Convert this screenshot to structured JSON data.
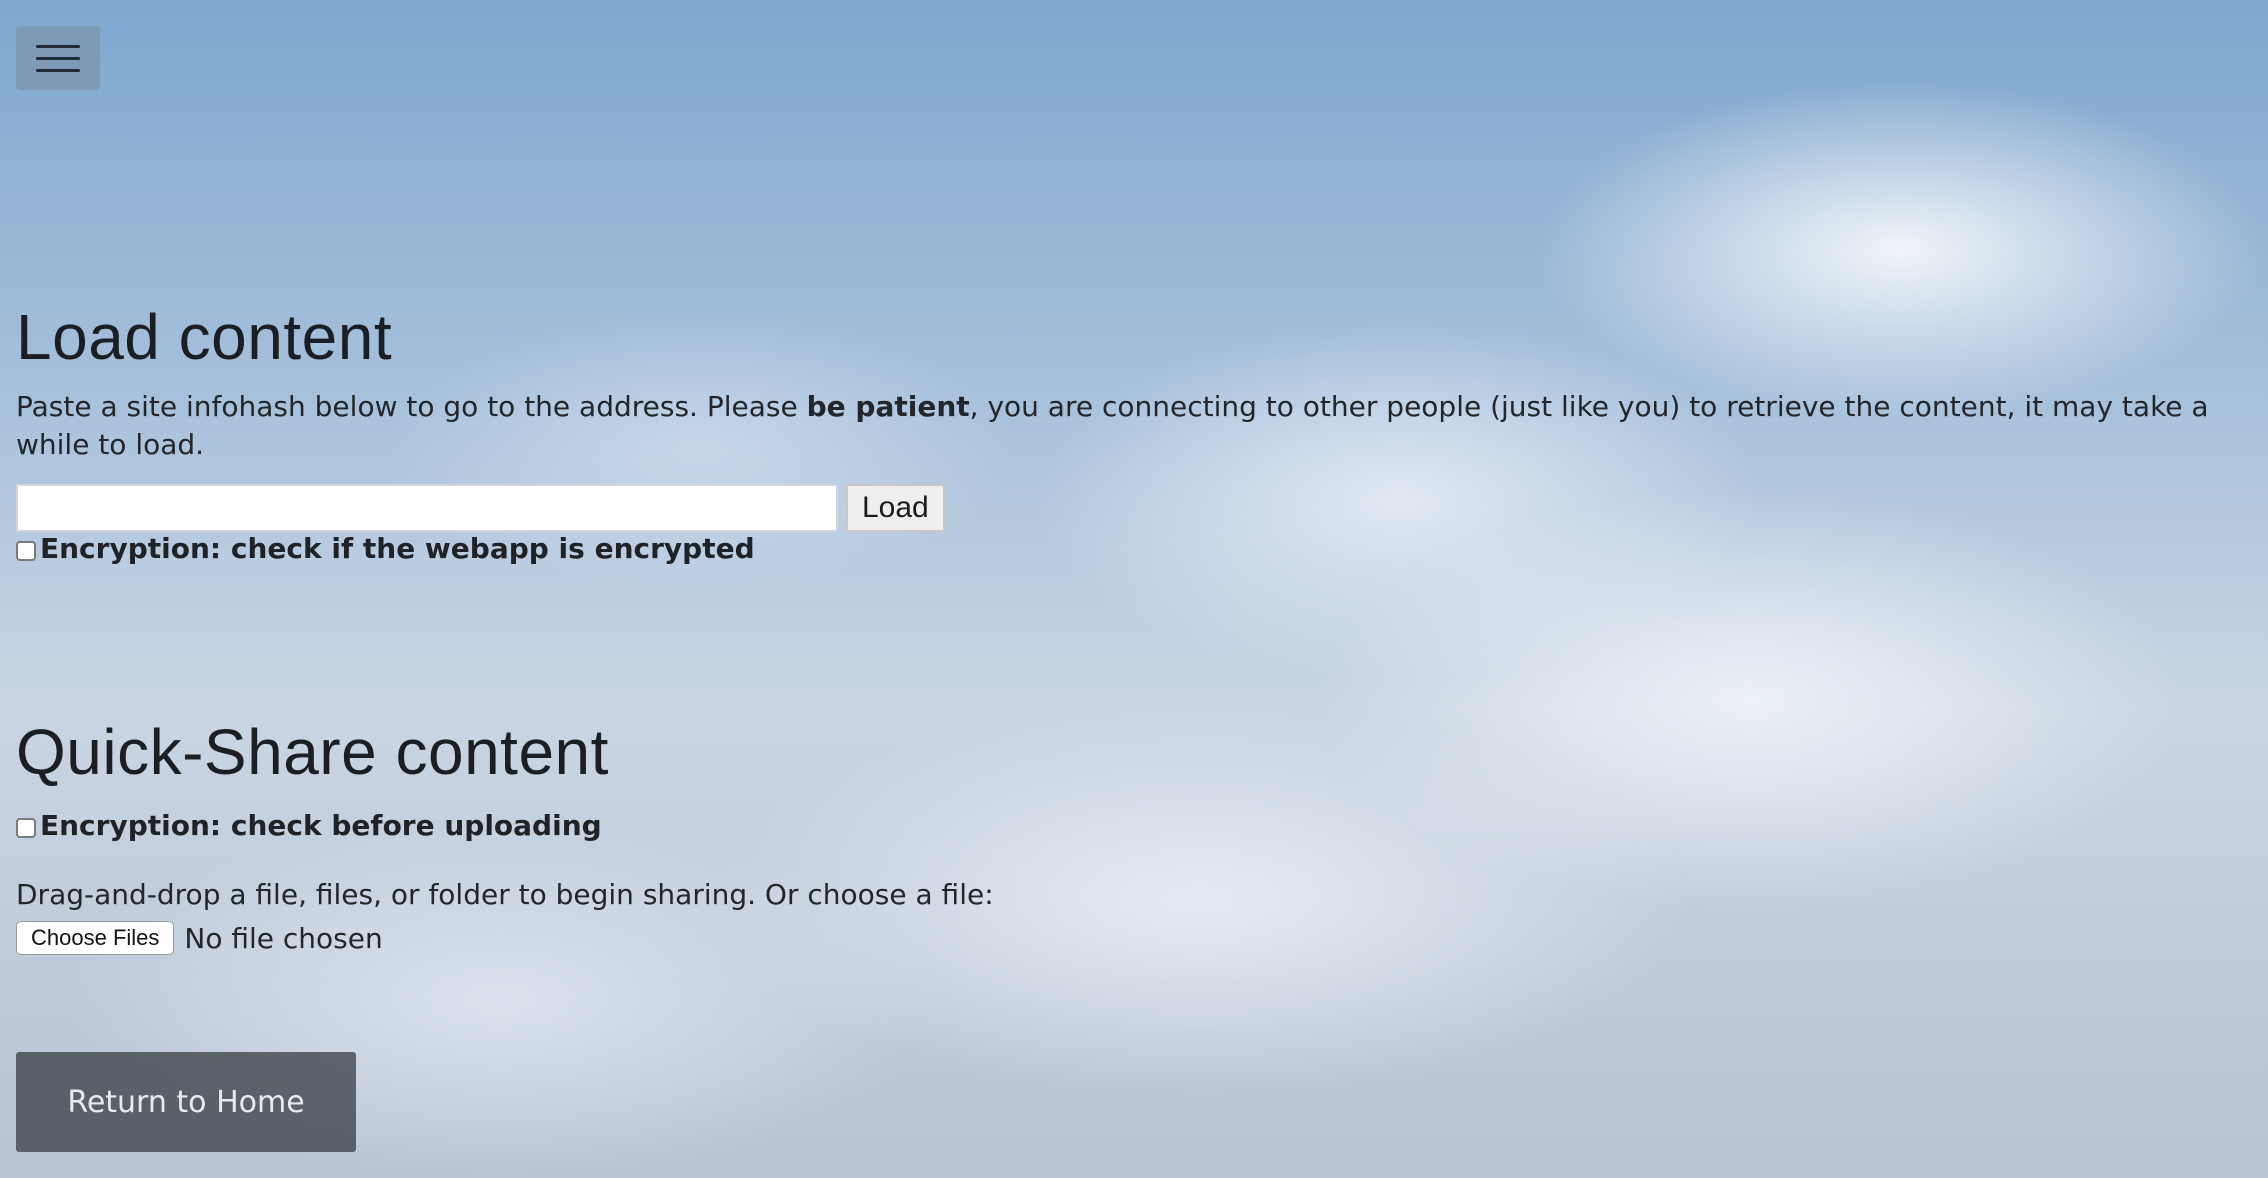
{
  "menu": {
    "icon": "hamburger-menu-icon"
  },
  "load_section": {
    "title": "Load content",
    "description_before": "Paste a site infohash below to go to the address. Please ",
    "description_bold": "be patient",
    "description_after": ", you are connecting to other people (just like you) to retrieve the content, it may take a while to load.",
    "input_value": "",
    "input_placeholder": "",
    "load_button_label": "Load",
    "encryption_label": "Encryption: check if the webapp is encrypted"
  },
  "share_section": {
    "title": "Quick-Share content",
    "encryption_label": "Encryption: check before uploading",
    "instructions": "Drag-and-drop a file, files, or folder to begin sharing. Or choose a file:",
    "choose_files_label": "Choose Files",
    "file_status": "No file chosen"
  },
  "footer": {
    "home_button_label": "Return to Home"
  }
}
